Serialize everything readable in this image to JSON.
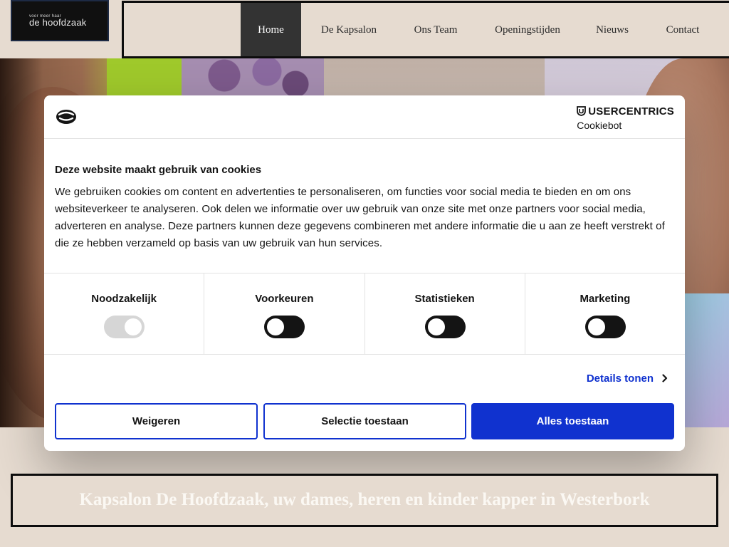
{
  "header": {
    "logo": {
      "tagline": "voor meer haar",
      "name": "de hoofdzaak"
    },
    "nav": [
      {
        "label": "Home",
        "active": true
      },
      {
        "label": "De Kapsalon",
        "active": false
      },
      {
        "label": "Ons Team",
        "active": false
      },
      {
        "label": "Openingstijden",
        "active": false
      },
      {
        "label": "Nieuws",
        "active": false
      },
      {
        "label": "Contact",
        "active": false
      }
    ]
  },
  "cookie_dialog": {
    "brand_top": "USERCENTRICS",
    "brand_bottom": "Cookiebot",
    "title": "Deze website maakt gebruik van cookies",
    "body": "We gebruiken cookies om content en advertenties te personaliseren, om functies voor social media te bieden en om ons websiteverkeer te analyseren. Ook delen we informatie over uw gebruik van onze site met onze partners voor social media, adverteren en analyse. Deze partners kunnen deze gegevens combineren met andere informatie die u aan ze heeft verstrekt of die ze hebben verzameld op basis van uw gebruik van hun services.",
    "categories": [
      {
        "label": "Noodzakelijk",
        "enabled": true,
        "locked": true
      },
      {
        "label": "Voorkeuren",
        "enabled": false,
        "locked": false
      },
      {
        "label": "Statistieken",
        "enabled": false,
        "locked": false
      },
      {
        "label": "Marketing",
        "enabled": false,
        "locked": false
      }
    ],
    "details_label": "Details tonen",
    "buttons": {
      "deny": "Weigeren",
      "selection": "Selectie toestaan",
      "allow_all": "Alles toestaan"
    }
  },
  "banner": {
    "text": "Kapsalon De Hoofdzaak, uw dames, heren en kinder kapper in Westerbork"
  },
  "colors": {
    "accent": "#1032cf",
    "background": "#e6dbd0",
    "nav_active": "#333333"
  },
  "icons": {
    "cookie_logo": "cookiebot-icon",
    "brand_shield": "usercentrics-shield-icon",
    "details_arrow": "chevron-right-icon"
  }
}
